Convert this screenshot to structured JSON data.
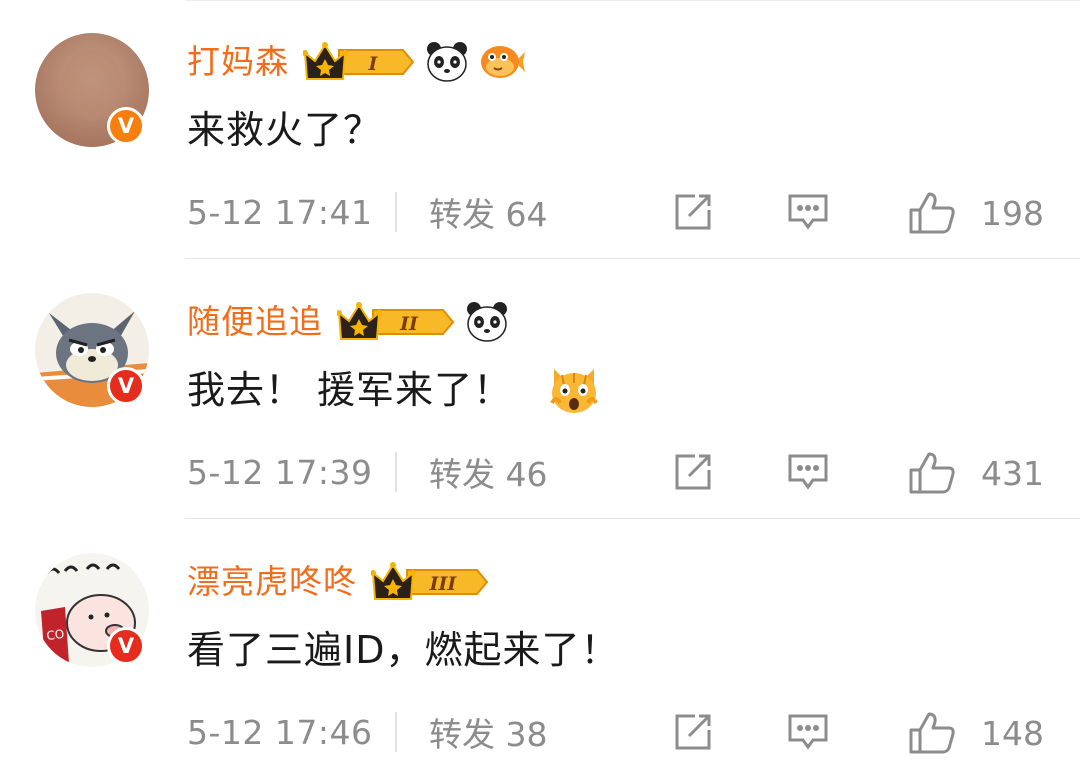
{
  "comments": [
    {
      "username": "打妈森",
      "level": "I",
      "text": "来救火了？",
      "time": "5-12 17:41",
      "repost": "转发 64",
      "likes": "198",
      "badge": "V",
      "icons": [
        "crown-level-icon",
        "panda-icon",
        "fish-icon"
      ]
    },
    {
      "username": "随便追追",
      "level": "II",
      "text": "我去！ 援军来了！",
      "time": "5-12 17:39",
      "repost": "转发 46",
      "likes": "431",
      "badge": "V",
      "icons": [
        "crown-level-icon",
        "panda-icon",
        "scared-cat-icon"
      ]
    },
    {
      "username": "漂亮虎咚咚",
      "level": "III",
      "text": "看了三遍ID，燃起来了！",
      "time": "5-12 17:46",
      "repost": "转发 38",
      "likes": "148",
      "badge": "V",
      "icons": [
        "crown-level-icon"
      ]
    }
  ],
  "colors": {
    "username": "#f26d1b",
    "meta": "#8c8c8c",
    "text": "#1a1a1a",
    "badge_orange": "#f77f0e",
    "badge_red": "#e52c1d"
  }
}
